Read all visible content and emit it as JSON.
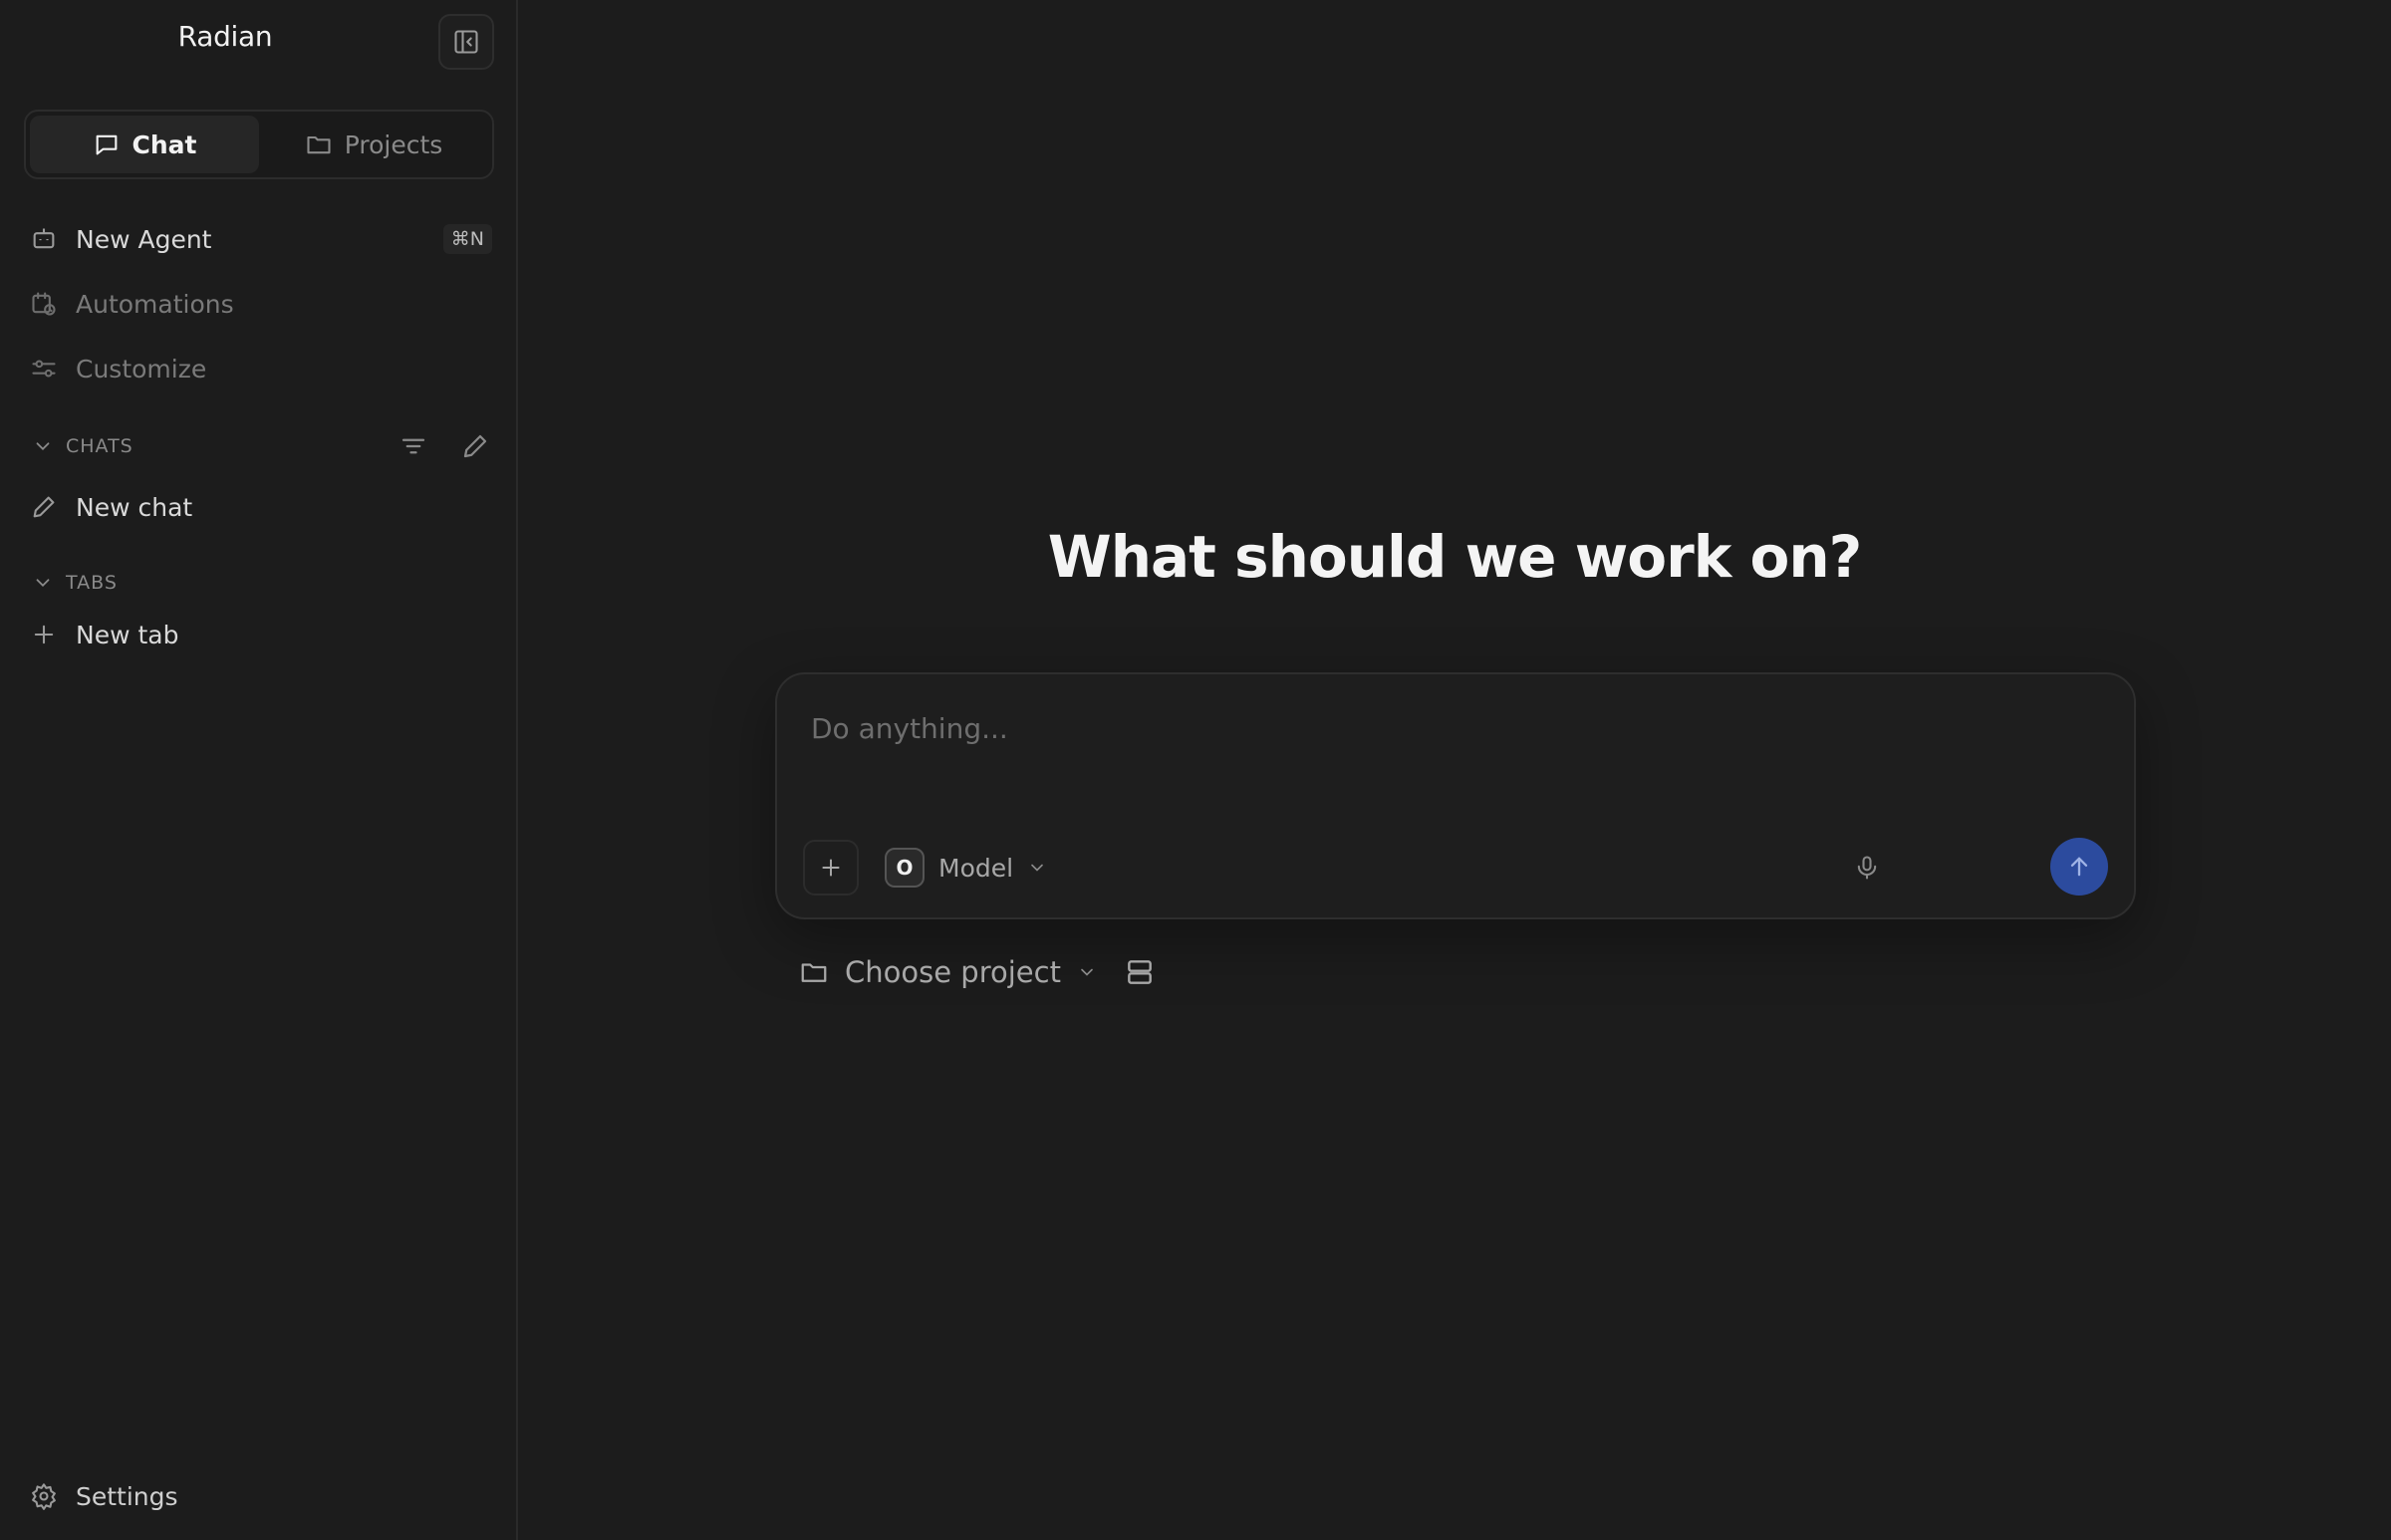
{
  "app": {
    "title": "Radian"
  },
  "sidebar": {
    "segments": [
      {
        "label": "Chat",
        "icon": "chat-bubble-icon",
        "active": true
      },
      {
        "label": "Projects",
        "icon": "folder-icon",
        "active": false
      }
    ],
    "nav": [
      {
        "label": "New Agent",
        "icon": "robot-icon",
        "shortcut": "⌘N"
      },
      {
        "label": "Automations",
        "icon": "calendar-clock-icon"
      },
      {
        "label": "Customize",
        "icon": "sliders-icon"
      }
    ],
    "chats_section": {
      "label": "CHATS",
      "items": [
        {
          "label": "New chat",
          "icon": "pencil-icon"
        }
      ]
    },
    "tabs_section": {
      "label": "TABS",
      "items": [
        {
          "label": "New tab",
          "icon": "plus-icon"
        }
      ]
    },
    "settings_label": "Settings"
  },
  "main": {
    "headline": "What should we work on?",
    "composer": {
      "placeholder": "Do anything...",
      "model_badge": "O",
      "model_label": "Model"
    },
    "project_picker_label": "Choose project"
  },
  "colors": {
    "background": "#1c1c1c",
    "send_button": "#2c4b9e",
    "text_primary": "#f4f4f4",
    "text_muted": "#7a7a7a"
  }
}
